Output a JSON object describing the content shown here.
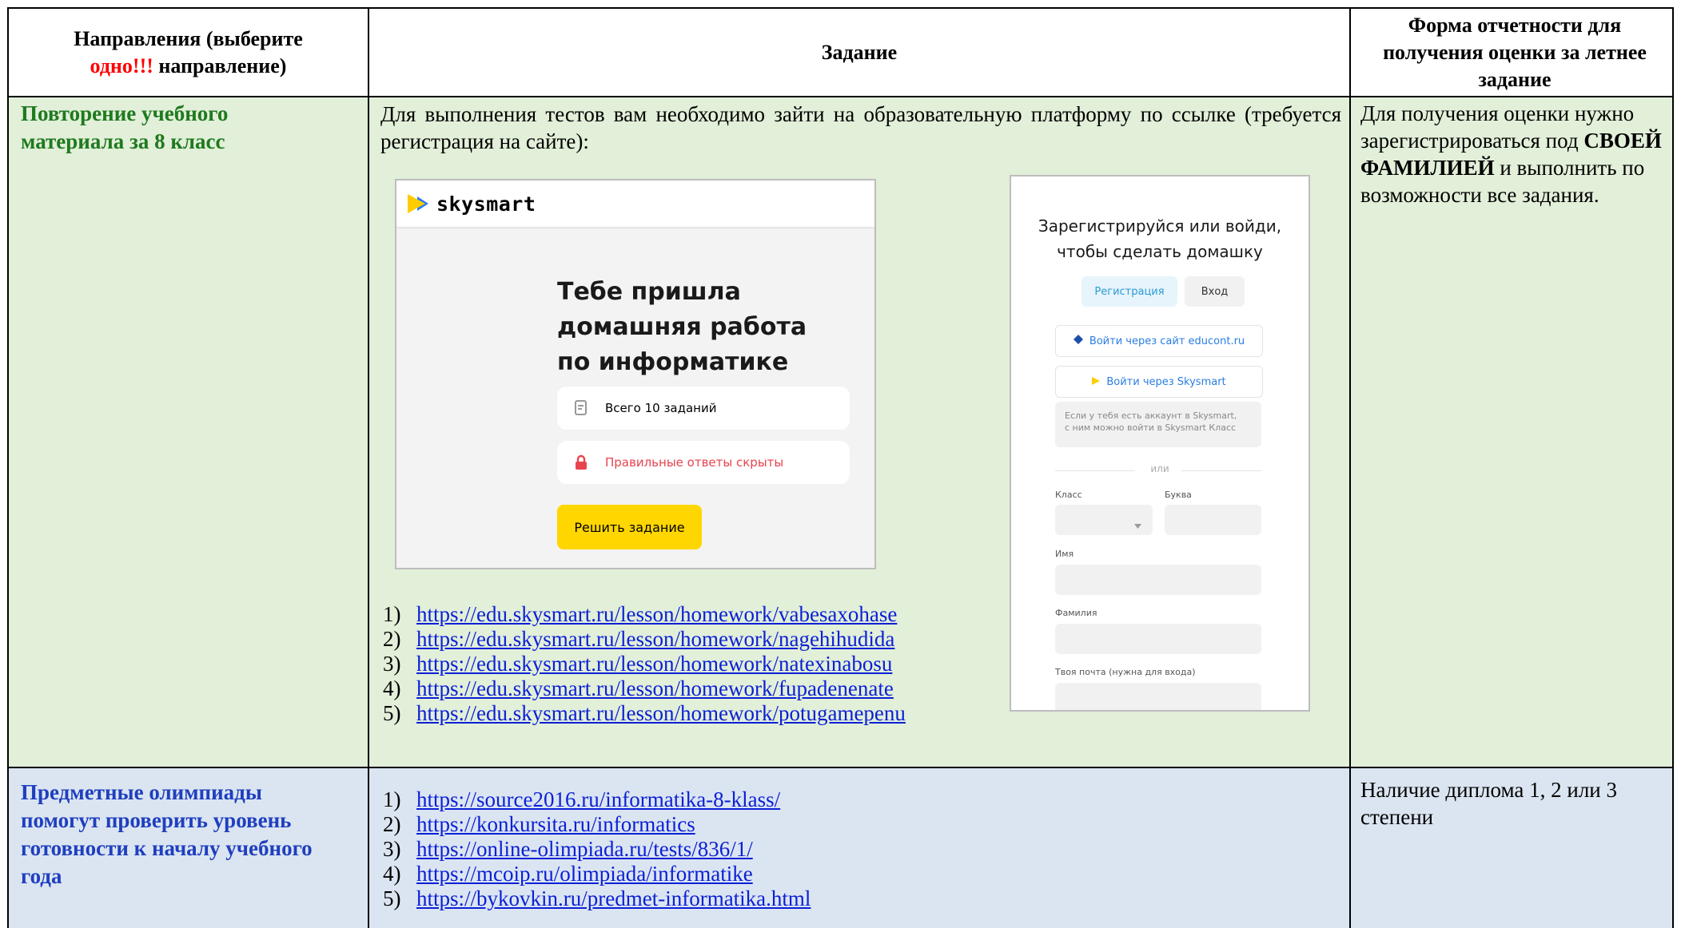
{
  "header": {
    "col1_part1": "Направления (выберите",
    "col1_red": "одно!!!",
    "col1_part2": "направление)",
    "col2": "Задание",
    "col3": "Форма отчетности для получения оценки за летнее задание"
  },
  "row1": {
    "topic": "Повторение учебного материала за 8 класс",
    "intro": "Для выполнения тестов вам необходимо зайти на образовательную платформу по ссылке (требуется регистрация на сайте):",
    "report_part1": "Для получения оценки нужно зарегистрироваться под",
    "report_bold": "СВОЕЙ ФАМИЛИЕЙ",
    "report_part2": "и выполнить по возможности все задания.",
    "links": [
      {
        "num": "1)",
        "url": "https://edu.skysmart.ru/lesson/homework/vabesaxohase"
      },
      {
        "num": "2)",
        "url": "https://edu.skysmart.ru/lesson/homework/nagehihudida"
      },
      {
        "num": "3)",
        "url": "https://edu.skysmart.ru/lesson/homework/natexinabosu"
      },
      {
        "num": "4)",
        "url": "https://edu.skysmart.ru/lesson/homework/fupadenenate"
      },
      {
        "num": "5)",
        "url": "https://edu.skysmart.ru/lesson/homework/potugamepenu"
      }
    ]
  },
  "row2": {
    "topic": "Предметные олимпиады помогут проверить уровень готовности к началу учебного года",
    "report": "Наличие диплома 1, 2 или 3 степени",
    "links": [
      {
        "num": "1)",
        "url": "https://source2016.ru/informatika-8-klass/"
      },
      {
        "num": "2)",
        "url": "https://konkursita.ru/informatics"
      },
      {
        "num": "3)",
        "url": "https://online-olimpiada.ru/tests/836/1/"
      },
      {
        "num": "4)",
        "url": "https://mcoip.ru/olimpiada/informatike"
      },
      {
        "num": "5)",
        "url": "https://bykovkin.ru/predmet-informatika.html"
      }
    ]
  },
  "skysmart": {
    "logo": "skysmart",
    "title_l1": "Тебе пришла",
    "title_l2": "домашняя работа",
    "title_l3": "по информатике",
    "tasks": "Всего 10 заданий",
    "answers_hidden": "Правильные ответы скрыты",
    "solve_button": "Решить задание",
    "colors": {
      "accent": "#ffd600",
      "warning": "#e8434f",
      "brand_blue": "#2b7bf5"
    }
  },
  "register": {
    "title_l1": "Зарегистрируйся или войди,",
    "title_l2": "чтобы сделать домашку",
    "tab_register": "Регистрация",
    "tab_login": "Вход",
    "educont_button": "Войти через сайт educont.ru",
    "skysmart_button": "Войти через Skysmart",
    "note_l1": "Если у тебя есть аккаунт в Skysmart,",
    "note_l2": "с ним можно войти в Skysmart Класс",
    "or": "или",
    "class_label": "Класс",
    "letter_label": "Буква",
    "name_label": "Имя",
    "surname_label": "Фамилия",
    "email_label": "Твоя почта (нужна для входа)"
  }
}
